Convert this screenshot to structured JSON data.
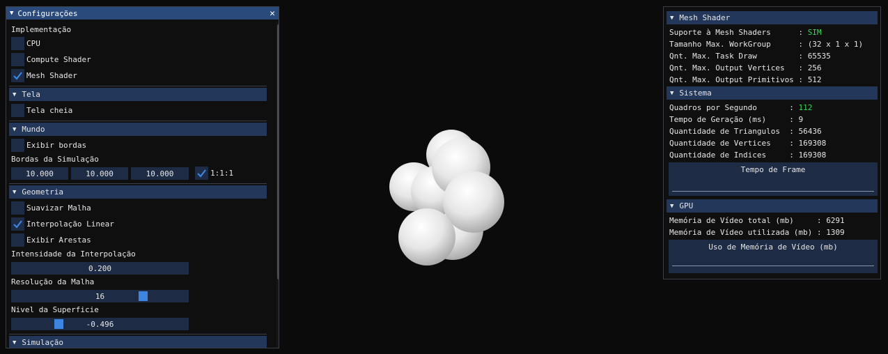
{
  "config": {
    "title": "Configurações",
    "implementation": {
      "label": "Implementação",
      "options": [
        {
          "label": "CPU",
          "checked": false
        },
        {
          "label": "Compute Shader",
          "checked": false
        },
        {
          "label": "Mesh Shader",
          "checked": true
        }
      ]
    },
    "tela": {
      "header": "Tela",
      "fullscreen": {
        "label": "Tela cheia",
        "checked": false
      }
    },
    "mundo": {
      "header": "Mundo",
      "show_borders": {
        "label": "Exibir bordas",
        "checked": false
      },
      "bounds_label": "Bordas da Simulação",
      "bounds": [
        "10.000",
        "10.000",
        "10.000"
      ],
      "ratio": {
        "label": "1:1:1",
        "checked": true
      }
    },
    "geometria": {
      "header": "Geometria",
      "smooth": {
        "label": "Suavizar Malha",
        "checked": false
      },
      "linear": {
        "label": "Interpolação Linear",
        "checked": true
      },
      "edges": {
        "label": "Exibir Arestas",
        "checked": false
      },
      "intensity_label": "Intensidade da Interpolação",
      "intensity_value": "0.200",
      "resolution_label": "Resolução da Malha",
      "resolution_value": "16",
      "resolution_fraction": 0.76,
      "surface_label": "Nivel da Superficie",
      "surface_value": "-0.496",
      "surface_fraction": 0.25
    },
    "simulacao": {
      "header": "Simulação"
    }
  },
  "stats": {
    "mesh": {
      "header": "Mesh Shader",
      "rows": [
        {
          "label": "Suporte à Mesh Shaders     ",
          "value": "SIM",
          "highlight": true
        },
        {
          "label": "Tamanho Max. WorkGroup     ",
          "value": "(32 x 1 x 1)",
          "highlight": false
        },
        {
          "label": "Qnt. Max. Task Draw        ",
          "value": "65535",
          "highlight": false
        },
        {
          "label": "Qnt. Max. Output Vertices  ",
          "value": "256",
          "highlight": false
        },
        {
          "label": "Qnt. Max. Output Primitivos",
          "value": "512",
          "highlight": false
        }
      ]
    },
    "sistema": {
      "header": "Sistema",
      "rows": [
        {
          "label": "Quadros por Segundo      ",
          "value": "112",
          "highlight": true
        },
        {
          "label": "Tempo de Geração (ms)    ",
          "value": "9",
          "highlight": false
        },
        {
          "label": "Quantidade de Triangulos ",
          "value": "56436",
          "highlight": false
        },
        {
          "label": "Quantidade de Vertices   ",
          "value": "169308",
          "highlight": false
        },
        {
          "label": "Quantidade de Indices    ",
          "value": "169308",
          "highlight": false
        }
      ],
      "plot_title": "Tempo de Frame"
    },
    "gpu": {
      "header": "GPU",
      "rows": [
        {
          "label": "Memória de Vídeo total (mb)    ",
          "value": "6291",
          "highlight": false
        },
        {
          "label": "Memória de Vídeo utilizada (mb)",
          "value": "1309",
          "highlight": false
        }
      ],
      "plot_title": "Uso de Memória de Vídeo (mb)"
    }
  },
  "colors": {
    "accent": "#3d85e0",
    "header": "#22375a",
    "title": "#294a7a",
    "frame": "#1d2b45",
    "good": "#33dd55"
  }
}
